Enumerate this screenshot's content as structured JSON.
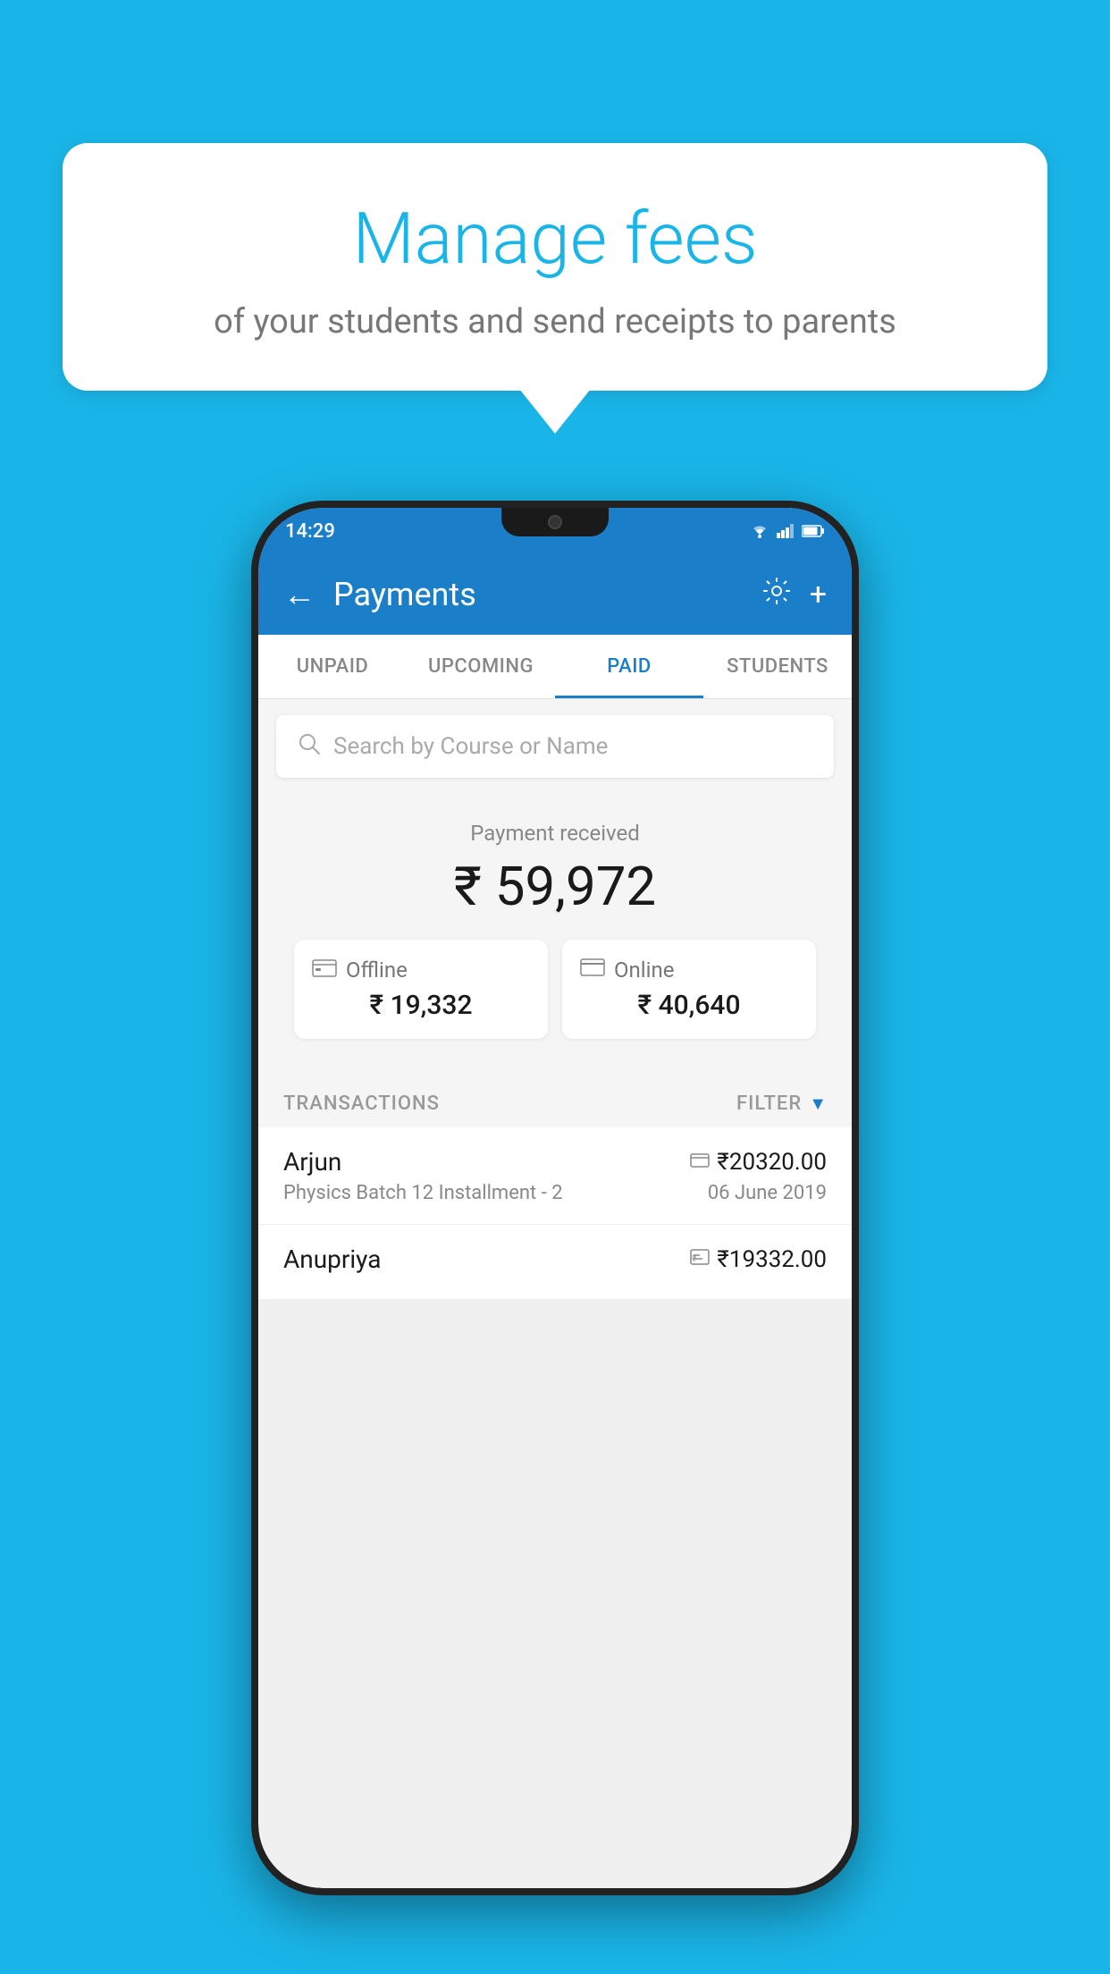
{
  "page": {
    "background_color": "#1ab5e8"
  },
  "speech_bubble": {
    "title": "Manage fees",
    "subtitle": "of your students and send receipts to parents"
  },
  "status_bar": {
    "time": "14:29",
    "wifi": "▼",
    "signal": "▲",
    "battery": "▮"
  },
  "header": {
    "title": "Payments",
    "back_label": "←",
    "gear_label": "⚙",
    "plus_label": "+"
  },
  "tabs": [
    {
      "label": "UNPAID",
      "active": false
    },
    {
      "label": "UPCOMING",
      "active": false
    },
    {
      "label": "PAID",
      "active": true
    },
    {
      "label": "STUDENTS",
      "active": false
    }
  ],
  "search": {
    "placeholder": "Search by Course or Name"
  },
  "payment_received": {
    "label": "Payment received",
    "amount": "₹ 59,972"
  },
  "cards": [
    {
      "type": "Offline",
      "amount": "₹ 19,332",
      "icon": "💳"
    },
    {
      "type": "Online",
      "amount": "₹ 40,640",
      "icon": "💳"
    }
  ],
  "transactions": {
    "section_label": "TRANSACTIONS",
    "filter_label": "FILTER",
    "items": [
      {
        "name": "Arjun",
        "description": "Physics Batch 12 Installment - 2",
        "amount": "₹20320.00",
        "date": "06 June 2019",
        "icon_type": "online"
      },
      {
        "name": "Anupriya",
        "description": "",
        "amount": "₹19332.00",
        "date": "",
        "icon_type": "offline"
      }
    ]
  }
}
